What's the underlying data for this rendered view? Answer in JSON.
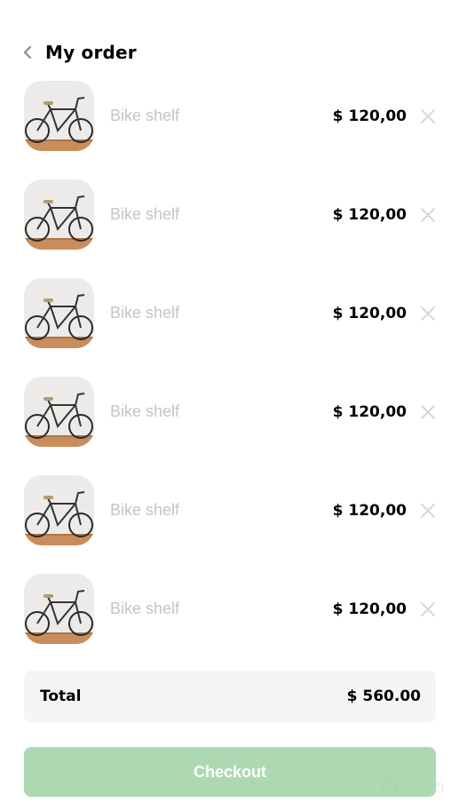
{
  "header": {
    "title": "My order",
    "back_icon": "chevron-left-icon"
  },
  "items": [
    {
      "name": "Bike shelf",
      "price": "$ 120,00",
      "image": "bicycle-photo",
      "remove_icon": "close-icon"
    },
    {
      "name": "Bike shelf",
      "price": "$ 120,00",
      "image": "bicycle-photo",
      "remove_icon": "close-icon"
    },
    {
      "name": "Bike shelf",
      "price": "$ 120,00",
      "image": "bicycle-photo",
      "remove_icon": "close-icon"
    },
    {
      "name": "Bike shelf",
      "price": "$ 120,00",
      "image": "bicycle-photo",
      "remove_icon": "close-icon"
    },
    {
      "name": "Bike shelf",
      "price": "$ 120,00",
      "image": "bicycle-photo",
      "remove_icon": "close-icon"
    },
    {
      "name": "Bike shelf",
      "price": "$ 120,00",
      "image": "bicycle-photo",
      "remove_icon": "close-icon"
    }
  ],
  "total": {
    "label": "Total",
    "value": "$ 560.00"
  },
  "checkout": {
    "label": "Checkout"
  },
  "watermark": {
    "text": "Platzi"
  },
  "colors": {
    "accent": "#acd9b2",
    "muted_text": "#c4c4c4",
    "total_bg": "#f5f5f5"
  }
}
